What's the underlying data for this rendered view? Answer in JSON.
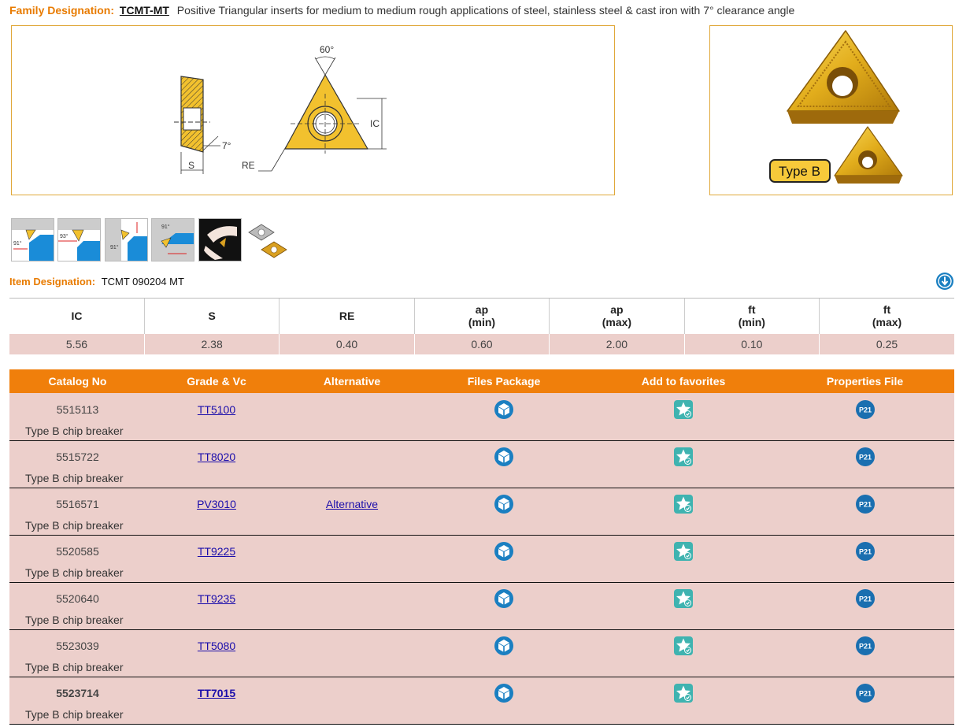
{
  "header": {
    "family_label": "Family Designation:",
    "family_code": "TCMT-MT",
    "description": "Positive Triangular inserts for medium to medium rough applications of steel, stainless steel & cast iron with 7° clearance angle"
  },
  "drawing": {
    "angle_top": "60°",
    "clearance": "7°",
    "ic": "IC",
    "s": "S",
    "re": "RE"
  },
  "photo": {
    "badge": "Type B"
  },
  "thumbnails": [
    {
      "name": "thumb-turning-91",
      "angle": "91°"
    },
    {
      "name": "thumb-turning-93",
      "angle": "93°"
    },
    {
      "name": "thumb-facing-91",
      "angle": "91°"
    },
    {
      "name": "thumb-profiling-91",
      "angle": "91°"
    },
    {
      "name": "thumb-hand-insert",
      "angle": ""
    },
    {
      "name": "thumb-insert-pair",
      "angle": ""
    }
  ],
  "item": {
    "label": "Item Designation:",
    "value": "TCMT 090204 MT"
  },
  "dims": {
    "headers": [
      [
        "IC",
        ""
      ],
      [
        "S",
        ""
      ],
      [
        "RE",
        ""
      ],
      [
        "ap",
        "(min)"
      ],
      [
        "ap",
        "(max)"
      ],
      [
        "ft",
        "(min)"
      ],
      [
        "ft",
        "(max)"
      ]
    ],
    "values": [
      "5.56",
      "2.38",
      "0.40",
      "0.60",
      "2.00",
      "0.10",
      "0.25"
    ]
  },
  "catalog": {
    "headers": [
      "Catalog No",
      "Grade & Vc",
      "Alternative",
      "Files Package",
      "Add to favorites",
      "Properties File"
    ],
    "properties_badge": "P21",
    "rows": [
      {
        "no": "5515113",
        "grade": "TT5100",
        "alt": "",
        "sub": "Type B chip breaker"
      },
      {
        "no": "5515722",
        "grade": "TT8020",
        "alt": "",
        "sub": "Type B chip breaker"
      },
      {
        "no": "5516571",
        "grade": "PV3010",
        "alt": "Alternative",
        "sub": "Type B chip breaker"
      },
      {
        "no": "5520585",
        "grade": "TT9225",
        "alt": "",
        "sub": "Type B chip breaker"
      },
      {
        "no": "5520640",
        "grade": "TT9235",
        "alt": "",
        "sub": "Type B chip breaker"
      },
      {
        "no": "5523039",
        "grade": "TT5080",
        "alt": "",
        "sub": "Type B chip breaker"
      },
      {
        "no": "5523714",
        "grade": "TT7015",
        "alt": "",
        "sub": "Type B chip breaker"
      }
    ]
  },
  "colors": {
    "accent": "#f07f0b",
    "row_bg": "#eccfcb",
    "icon_blue": "#1a7fc1",
    "icon_teal": "#3fb3b0"
  }
}
